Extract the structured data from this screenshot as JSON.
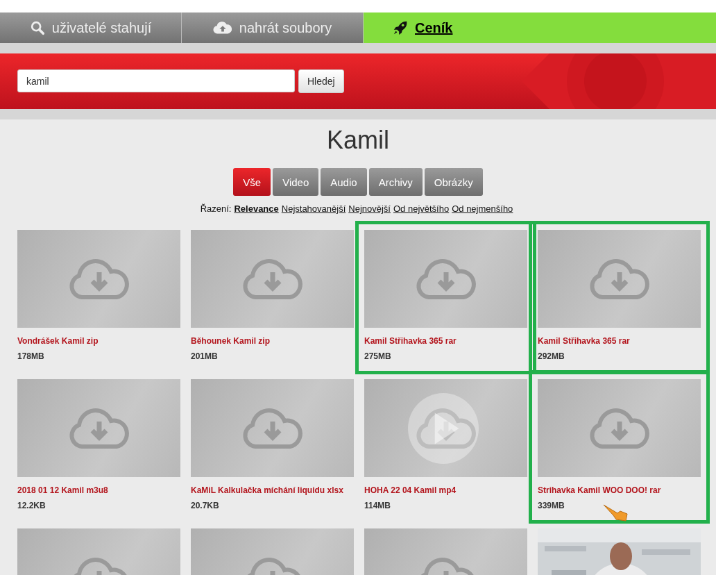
{
  "nav": [
    {
      "kind": "search",
      "label": "uživatelé stahují",
      "selected": false
    },
    {
      "kind": "upload",
      "label": "nahrát soubory",
      "selected": false
    },
    {
      "kind": "rocket",
      "label": "Ceník",
      "selected": true
    }
  ],
  "search": {
    "value": "kamil",
    "button": "Hledej"
  },
  "title": "Kamil",
  "filters": [
    {
      "label": "Vše",
      "selected": true
    },
    {
      "label": "Video",
      "selected": false
    },
    {
      "label": "Audio",
      "selected": false
    },
    {
      "label": "Archivy",
      "selected": false
    },
    {
      "label": "Obrázky",
      "selected": false
    }
  ],
  "sort": {
    "label": "Řazení:",
    "options": [
      {
        "label": "Relevance",
        "selected": true
      },
      {
        "label": "Nejstahovanější",
        "selected": false
      },
      {
        "label": "Nejnovější",
        "selected": false
      },
      {
        "label": "Od největšího",
        "selected": false
      },
      {
        "label": "Od nejmenšího",
        "selected": false
      }
    ]
  },
  "files": [
    {
      "kind": "file",
      "name": "Vondrášek Kamil zip",
      "size": "178MB",
      "highlighted": false
    },
    {
      "kind": "file",
      "name": "Běhounek Kamil zip",
      "size": "201MB",
      "highlighted": false
    },
    {
      "kind": "file",
      "name": "Kamil Střihavka 365 rar",
      "size": "275MB",
      "highlighted": true
    },
    {
      "kind": "file",
      "name": "Kamil Střihavka 365 rar",
      "size": "292MB",
      "highlighted": true
    },
    {
      "kind": "file",
      "name": "2018 01 12 Kamil m3u8",
      "size": "12.2KB",
      "highlighted": false
    },
    {
      "kind": "file",
      "name": "KaMiL Kalkulačka míchání liquidu xlsx",
      "size": "20.7KB",
      "highlighted": false
    },
    {
      "kind": "video",
      "name": "HOHA 22 04 Kamil mp4",
      "size": "114MB",
      "highlighted": false
    },
    {
      "kind": "file",
      "name": "Strihavka Kamil WOO DOO! rar",
      "size": "339MB",
      "highlighted": true
    },
    {
      "kind": "file",
      "highlighted": false
    },
    {
      "kind": "file",
      "highlighted": false
    },
    {
      "kind": "file",
      "highlighted": false
    },
    {
      "kind": "picture",
      "highlighted": false
    }
  ]
}
